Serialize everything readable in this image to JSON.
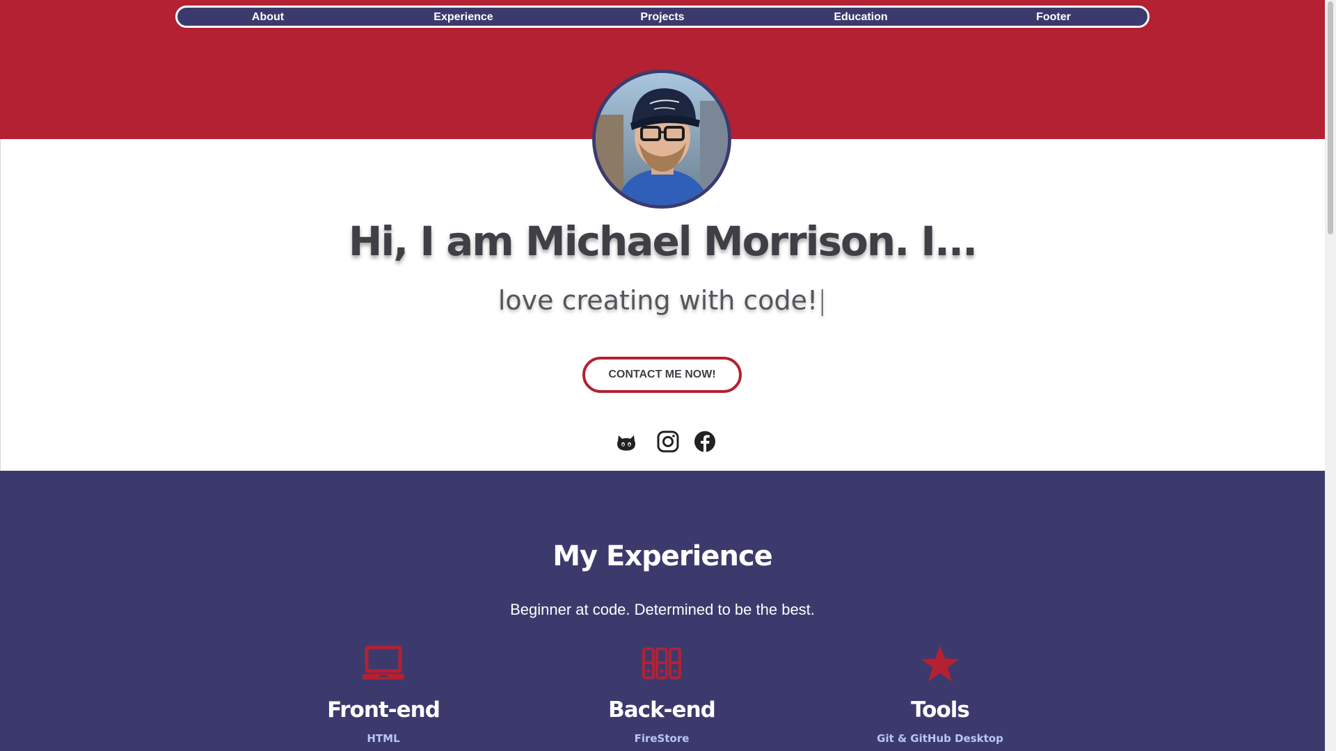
{
  "nav": {
    "items": [
      {
        "label": "About"
      },
      {
        "label": "Experience"
      },
      {
        "label": "Projects"
      },
      {
        "label": "Education"
      },
      {
        "label": "Footer"
      }
    ]
  },
  "hero": {
    "headline": "Hi, I am Michael Morrison. I...",
    "typed_text": "love creating with code!",
    "caret": "|",
    "contact_button": "CONTACT ME NOW!",
    "socials": [
      {
        "icon": "github-icon"
      },
      {
        "icon": "instagram-icon"
      },
      {
        "icon": "facebook-icon"
      }
    ]
  },
  "experience": {
    "title": "My Experience",
    "subtitle": "Beginner at code. Determined to be the best.",
    "columns": [
      {
        "icon": "laptop-icon",
        "title": "Front-end",
        "first_item": "HTML"
      },
      {
        "icon": "server-icon",
        "title": "Back-end",
        "first_item": "FireStore"
      },
      {
        "icon": "star-icon",
        "title": "Tools",
        "first_item": "Git & GitHub Desktop"
      }
    ]
  },
  "colors": {
    "brand_red": "#b32133",
    "brand_navy": "#3c3a6d",
    "link_blue": "#b9c6f4"
  }
}
